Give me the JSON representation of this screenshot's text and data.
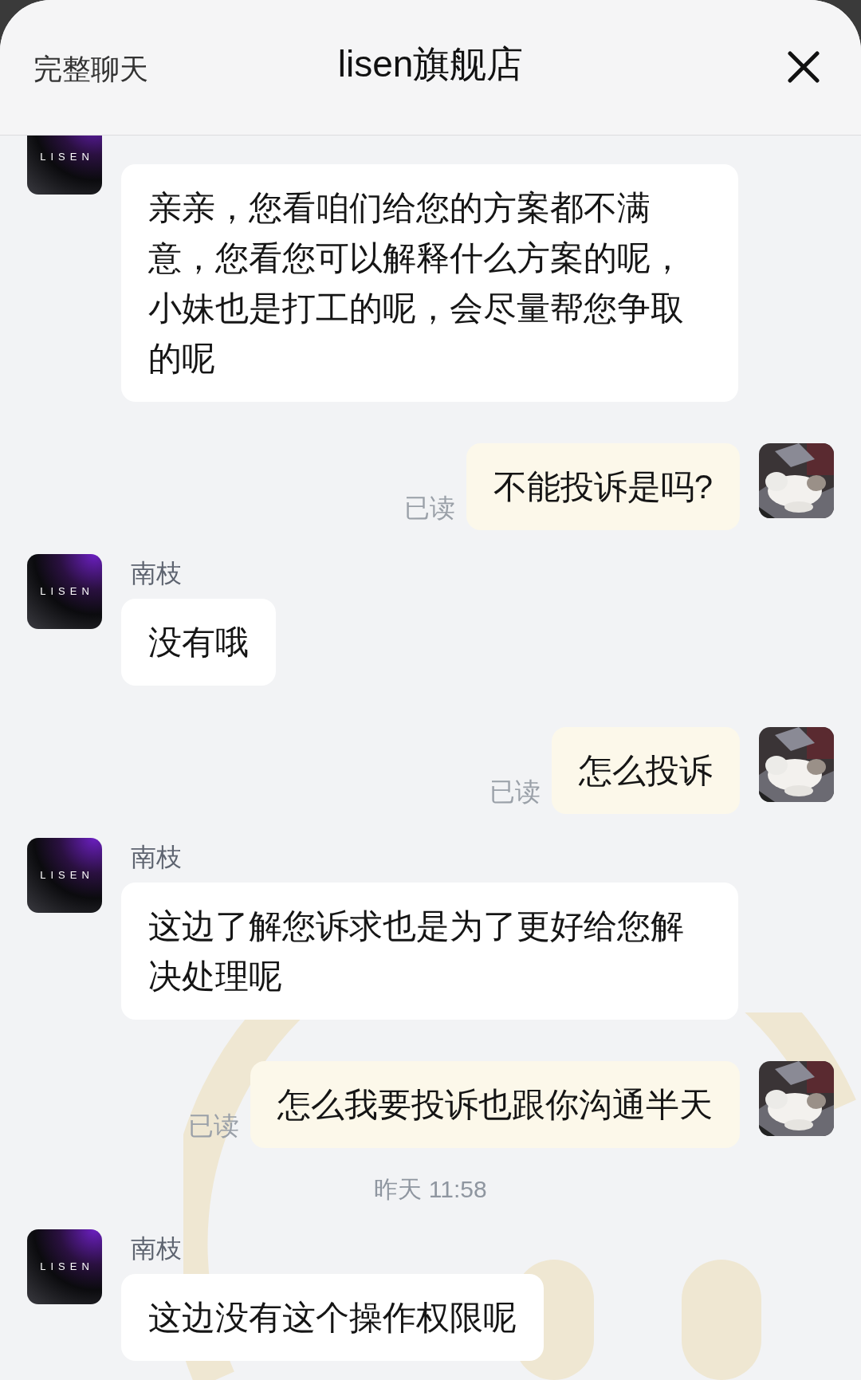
{
  "header": {
    "left_label": "完整聊天",
    "title": "lisen旗舰店"
  },
  "messages": [
    {
      "kind": "agent",
      "avatar_label": "LISEN",
      "text": "亲亲，您看咱们给您的方案都不满意，您看您可以解释什么方案的呢，小妹也是打工的呢，会尽量帮您争取的呢"
    },
    {
      "kind": "user",
      "status": "已读",
      "text": "不能投诉是吗?"
    },
    {
      "kind": "agent",
      "name": "南枝",
      "avatar_label": "LISEN",
      "text": "没有哦"
    },
    {
      "kind": "user",
      "status": "已读",
      "text": "怎么投诉"
    },
    {
      "kind": "agent",
      "name": "南枝",
      "avatar_label": "LISEN",
      "text": "这边了解您诉求也是为了更好给您解决处理呢"
    },
    {
      "kind": "user",
      "status": "已读",
      "text": "怎么我要投诉也跟你沟通半天"
    },
    {
      "kind": "time",
      "text": "昨天 11:58"
    },
    {
      "kind": "agent",
      "name": "南枝",
      "avatar_label": "LISEN",
      "text": "这边没有这个操作权限呢"
    }
  ]
}
